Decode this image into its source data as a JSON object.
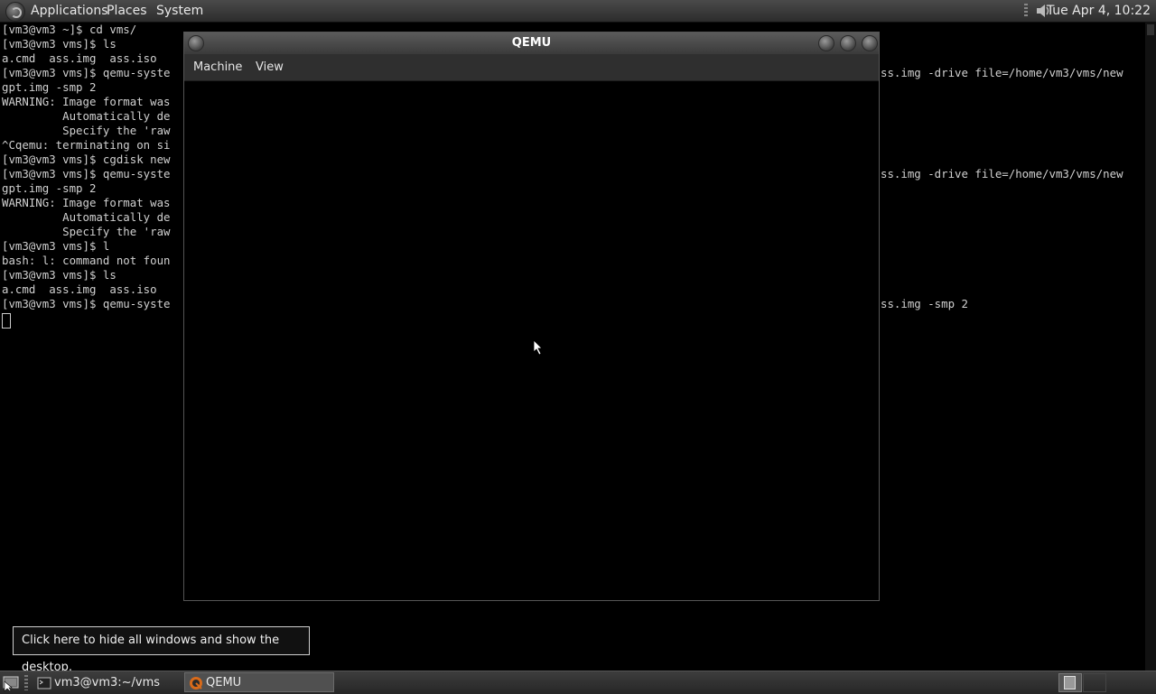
{
  "top_panel": {
    "applications": "Applications",
    "places": "Places",
    "system": "System",
    "clock": "Tue Apr  4, 10:22"
  },
  "terminal": {
    "lines": [
      "[vm3@vm3 ~]$ cd vms/",
      "[vm3@vm3 vms]$ ls",
      "a.cmd  ass.img  ass.iso  ",
      "[vm3@vm3 vms]$ qemu-syste",
      "gpt.img -smp 2",
      "WARNING: Image format was",
      "         Automatically de",
      "         Specify the 'raw",
      "^Cqemu: terminating on si",
      "[vm3@vm3 vms]$ cgdisk new",
      "[vm3@vm3 vms]$ qemu-syste",
      "gpt.img -smp 2",
      "WARNING: Image format was",
      "         Automatically de",
      "         Specify the 'raw",
      "[vm3@vm3 vms]$ l",
      "bash: l: command not foun",
      "[vm3@vm3 vms]$ ls",
      "a.cmd  ass.img  ass.iso  ",
      "[vm3@vm3 vms]$ qemu-syste"
    ],
    "tail_1": "ss.img -drive file=/home/vm3/vms/new",
    "tail_2": "ss.img -drive file=/home/vm3/vms/new",
    "tail_3": "ss.img -smp 2"
  },
  "qemu": {
    "title": "QEMU",
    "menu_machine": "Machine",
    "menu_view": "View"
  },
  "tooltip": "Click here to hide all windows and show the desktop.",
  "taskbar": {
    "terminal_task": "vm3@vm3:~/vms",
    "qemu_task": "QEMU"
  }
}
